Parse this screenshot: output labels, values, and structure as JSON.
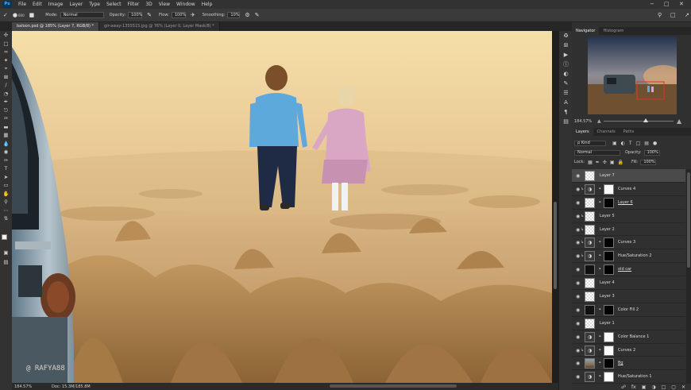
{
  "app": {
    "logo": "Ps"
  },
  "menu": [
    "File",
    "Edit",
    "Image",
    "Layer",
    "Type",
    "Select",
    "Filter",
    "3D",
    "View",
    "Window",
    "Help"
  ],
  "window_controls": [
    "−",
    "□",
    "✕"
  ],
  "options_bar": {
    "brush_size": "600",
    "mode_label": "Mode:",
    "mode_value": "Normal",
    "opacity_label": "Opacity:",
    "opacity_value": "100%",
    "flow_label": "Flow:",
    "flow_value": "100%",
    "smoothing_label": "Smoothing:",
    "smoothing_value": "10%"
  },
  "doc_tabs": [
    {
      "label": "baloon.psd @ 185% (Layer 7, RGB/8) *",
      "active": true
    },
    {
      "label": "gir-away-1355515.jpg @ 76% (Layer 0, Layer Mask/8) *",
      "active": false
    }
  ],
  "canvas": {
    "watermark": "@ RAFYA88"
  },
  "status": {
    "zoom": "184.57%",
    "doc_info": "Doc: 15.3M/185.8M"
  },
  "panel_tabs": {
    "top": [
      {
        "label": "Navigator",
        "active": true
      },
      {
        "label": "Histogram",
        "active": false
      }
    ],
    "layers": [
      {
        "label": "Layers",
        "active": true
      },
      {
        "label": "Channels",
        "active": false
      },
      {
        "label": "Paths",
        "active": false
      }
    ]
  },
  "navigator": {
    "zoom": "184.57%"
  },
  "layers_panel": {
    "kind_filter": "ρ Kind",
    "blend_mode": "Normal",
    "opacity_label": "Opacity:",
    "opacity_value": "100%",
    "lock_label": "Lock:",
    "fill_label": "Fill:",
    "fill_value": "100%",
    "items": [
      {
        "name": "Layer 7",
        "thumb": "check",
        "selected": true
      },
      {
        "name": "Curves 4",
        "thumb": "adj",
        "mask": "white",
        "clip": true
      },
      {
        "name": "Layer 6",
        "thumb": "check",
        "mask": "black",
        "underline": true
      },
      {
        "name": "Layer 5",
        "thumb": "check",
        "clip": true
      },
      {
        "name": "Layer 2",
        "thumb": "check",
        "clip": true
      },
      {
        "name": "Curves 3",
        "thumb": "adj",
        "mask": "black",
        "clip": true
      },
      {
        "name": "Hue/Saturation 2",
        "thumb": "adj",
        "mask": "black",
        "clip": true
      },
      {
        "name": "old car",
        "thumb": "black",
        "mask": "black",
        "underline": true
      },
      {
        "name": "Layer 4",
        "thumb": "check"
      },
      {
        "name": "Layer 3",
        "thumb": "check"
      },
      {
        "name": "Color Fill 2",
        "thumb": "black",
        "mask": "black"
      },
      {
        "name": "Layer 1",
        "thumb": "check"
      },
      {
        "name": "Color Balance 1",
        "thumb": "adj",
        "mask": "white"
      },
      {
        "name": "Curves 2",
        "thumb": "adj",
        "mask": "white",
        "clip": true
      },
      {
        "name": "Bg",
        "thumb": "scene",
        "mask": "black",
        "underline": true
      },
      {
        "name": "Hue/Saturation 1",
        "thumb": "adj",
        "mask": "white"
      }
    ],
    "footer_icons": [
      "fx",
      "▣",
      "◑",
      "□",
      "▢",
      "✕"
    ]
  }
}
